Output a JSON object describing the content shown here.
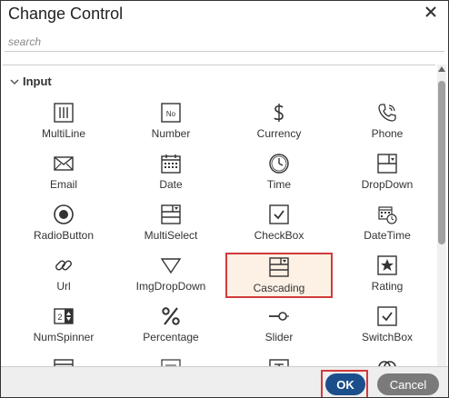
{
  "dialog": {
    "title": "Change Control",
    "search_placeholder": "search",
    "section": "Input",
    "ok_label": "OK",
    "cancel_label": "Cancel"
  },
  "controls": [
    {
      "label": "MultiLine",
      "icon": "multiline-icon"
    },
    {
      "label": "Number",
      "icon": "number-icon"
    },
    {
      "label": "Currency",
      "icon": "currency-icon"
    },
    {
      "label": "Phone",
      "icon": "phone-icon"
    },
    {
      "label": "Email",
      "icon": "email-icon"
    },
    {
      "label": "Date",
      "icon": "date-icon"
    },
    {
      "label": "Time",
      "icon": "time-icon"
    },
    {
      "label": "DropDown",
      "icon": "dropdown-icon"
    },
    {
      "label": "RadioButton",
      "icon": "radio-icon"
    },
    {
      "label": "MultiSelect",
      "icon": "multiselect-icon"
    },
    {
      "label": "CheckBox",
      "icon": "checkbox-icon"
    },
    {
      "label": "DateTime",
      "icon": "datetime-icon"
    },
    {
      "label": "Url",
      "icon": "url-icon"
    },
    {
      "label": "ImgDropDown",
      "icon": "imgdropdown-icon"
    },
    {
      "label": "Cascading",
      "icon": "cascading-icon",
      "selected": true
    },
    {
      "label": "Rating",
      "icon": "rating-icon"
    },
    {
      "label": "NumSpinner",
      "icon": "numspinner-icon"
    },
    {
      "label": "Percentage",
      "icon": "percentage-icon"
    },
    {
      "label": "Slider",
      "icon": "slider-icon"
    },
    {
      "label": "SwitchBox",
      "icon": "switchbox-icon"
    }
  ],
  "number_icon_text": "No",
  "numspinner_icon_text": "2",
  "colors": {
    "accent": "#1a4f8b",
    "selected_border": "#d23a3a",
    "selected_bg": "#fdf1e6"
  }
}
